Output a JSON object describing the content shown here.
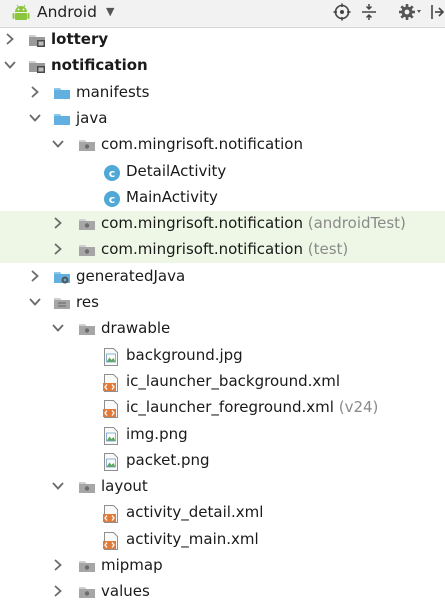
{
  "toolbar": {
    "title": "Android"
  },
  "tree": [
    {
      "label": "lottery",
      "bold": true,
      "arrow": "right",
      "icon": "module-folder-icon"
    },
    {
      "label": "notification",
      "bold": true,
      "arrow": "down",
      "icon": "module-folder-icon"
    },
    {
      "label": "manifests",
      "arrow": "right",
      "icon": "folder-icon"
    },
    {
      "label": "java",
      "arrow": "down",
      "icon": "folder-icon"
    },
    {
      "label": "com.mingrisoft.notification",
      "arrow": "down",
      "icon": "package-icon"
    },
    {
      "label": "DetailActivity",
      "icon": "class-icon"
    },
    {
      "label": "MainActivity",
      "icon": "class-icon"
    },
    {
      "label": "com.mingrisoft.notification",
      "suffix": "(androidTest)",
      "arrow": "right",
      "icon": "package-icon",
      "highlight": true
    },
    {
      "label": "com.mingrisoft.notification",
      "suffix": "(test)",
      "arrow": "right",
      "icon": "package-icon",
      "highlight": true
    },
    {
      "label": "generatedJava",
      "arrow": "right",
      "icon": "generated-folder-icon"
    },
    {
      "label": "res",
      "arrow": "down",
      "icon": "res-folder-icon"
    },
    {
      "label": "drawable",
      "arrow": "down",
      "icon": "package-icon"
    },
    {
      "label": "background.jpg",
      "icon": "image-file-icon"
    },
    {
      "label": "ic_launcher_background.xml",
      "icon": "xml-file-icon"
    },
    {
      "label": "ic_launcher_foreground.xml",
      "suffix": "(v24)",
      "icon": "xml-file-icon"
    },
    {
      "label": "img.png",
      "icon": "image-file-icon"
    },
    {
      "label": "packet.png",
      "icon": "image-file-icon"
    },
    {
      "label": "layout",
      "arrow": "down",
      "icon": "package-icon"
    },
    {
      "label": "activity_detail.xml",
      "icon": "xml-file-icon"
    },
    {
      "label": "activity_main.xml",
      "icon": "xml-file-icon"
    },
    {
      "label": "mipmap",
      "arrow": "right",
      "icon": "package-icon"
    },
    {
      "label": "values",
      "arrow": "right",
      "icon": "package-icon"
    }
  ]
}
